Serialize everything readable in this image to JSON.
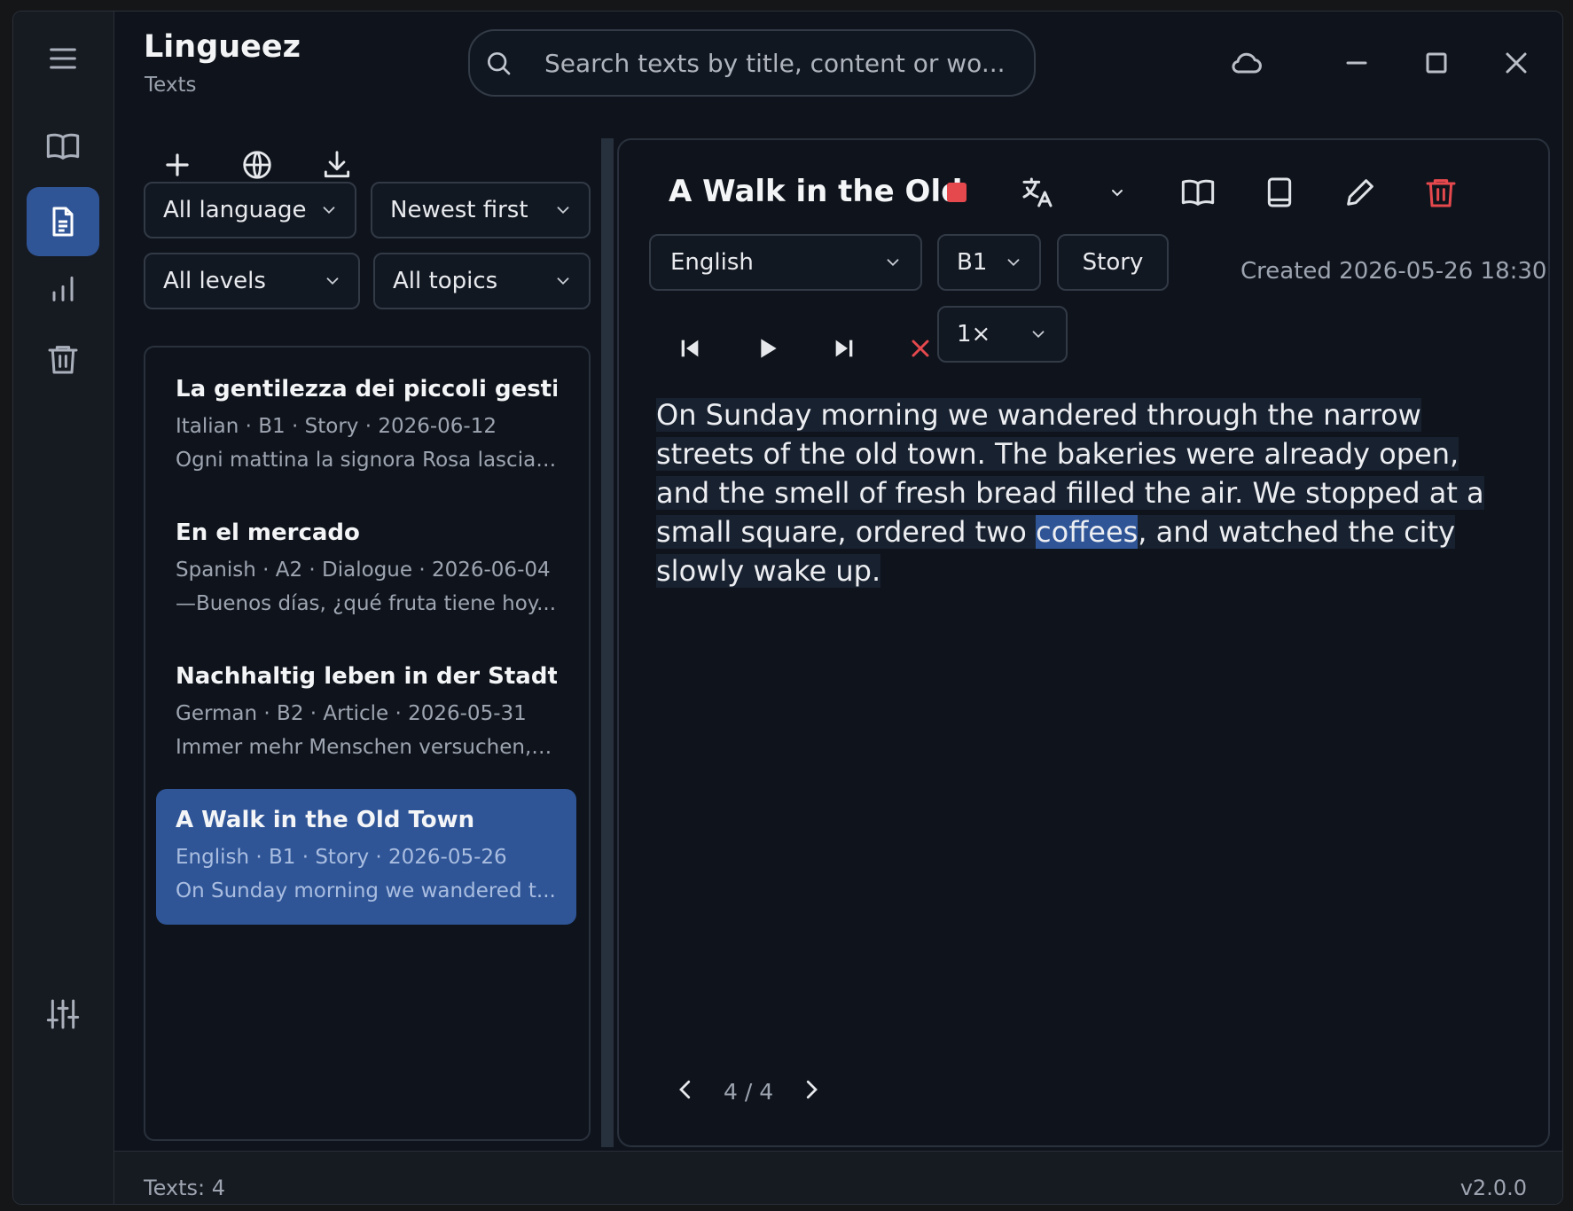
{
  "app": {
    "title": "Lingueez",
    "subtitle": "Texts"
  },
  "search": {
    "placeholder": "Search texts by title, content or wo..."
  },
  "rail": {
    "items": [
      {
        "icon": "menu-icon"
      },
      {
        "icon": "book-icon"
      },
      {
        "icon": "document-icon",
        "active": true
      },
      {
        "icon": "bar-chart-icon"
      },
      {
        "icon": "trash-icon"
      },
      {
        "icon": "sliders-icon"
      }
    ]
  },
  "window_controls": [
    "cloud-icon",
    "minimize-icon",
    "maximize-icon",
    "close-icon"
  ],
  "filters": {
    "language": "All language",
    "sort": "Newest first",
    "level": "All levels",
    "topic": "All topics"
  },
  "texts": [
    {
      "title": "La gentilezza dei piccoli gesti",
      "meta": "Italian · B1 · Story · 2026-06-12",
      "preview": "Ogni mattina la signora Rosa lascia ..."
    },
    {
      "title": "En el mercado",
      "meta": "Spanish · A2 · Dialogue · 2026-06-04",
      "preview": "—Buenos días, ¿qué fruta tiene hoy..."
    },
    {
      "title": "Nachhaltig leben in der Stadt",
      "meta": "German · B2 · Article · 2026-05-31",
      "preview": "Immer mehr Menschen versuchen, ..."
    },
    {
      "title": "A Walk in the Old Town",
      "meta": "English · B1 · Story · 2026-05-26",
      "preview": "On Sunday morning we wandered t...",
      "selected": true
    }
  ],
  "reader": {
    "title": "A Walk in the Old",
    "language": "English",
    "level": "B1",
    "type": "Story",
    "created": "Created 2026-05-26 18:30",
    "speed": "1×",
    "passage_before": "On Sunday morning we wandered through the narrow streets of the old town. The bakeries were already open, and the smell of fresh bread filled the air. We stopped at a small square, ordered two ",
    "passage_word": "coffees",
    "passage_after": ", and watched the city slowly wake up.",
    "page": "4 / 4"
  },
  "status": {
    "count": "Texts: 4",
    "version": "v2.0.0"
  },
  "colors": {
    "accent": "#2f5597",
    "danger": "#e5484d",
    "background": "#0f141c"
  }
}
